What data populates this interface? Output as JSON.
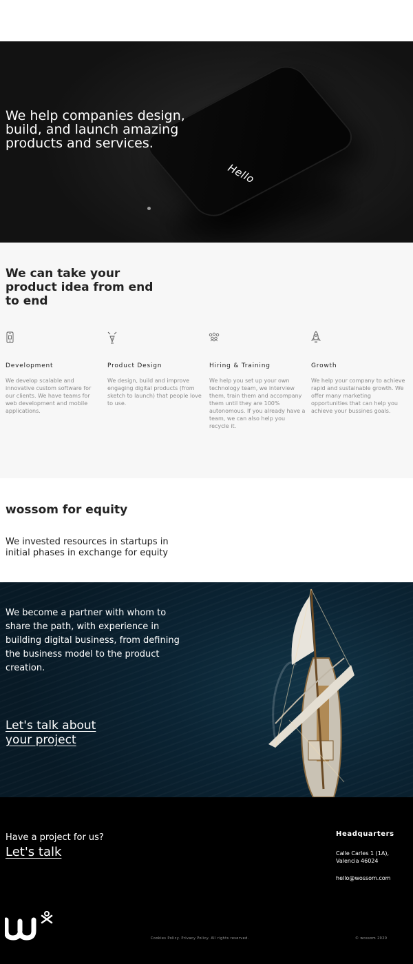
{
  "hero": {
    "title": "We help companies design, build, and launch amazing products and services.",
    "phone_text": "Hello"
  },
  "services": {
    "title": "We can take your product idea from end to end",
    "items": [
      {
        "icon": "phone-icon",
        "title": "Development",
        "desc": "We develop scalable and innovative custom software for our clients. We have teams for web development and mobile applications."
      },
      {
        "icon": "pen-nib-icon",
        "title": "Product Design",
        "desc": "We design, build and improve engaging digital products (from sketch to launch) that people love to use."
      },
      {
        "icon": "team-icon",
        "title": "Hiring & Training",
        "desc": "We help you set up your own technology team, we interview them, train them and accompany them until they are 100% autonomous. If you already have a team, we can also help you recycle it."
      },
      {
        "icon": "rocket-icon",
        "title": "Growth",
        "desc": "We help your company to achieve rapid and sustainable growth. We offer many marketing opportunities that can help you achieve your bussines goals."
      }
    ]
  },
  "equity": {
    "title": "wossom for equity",
    "subtitle": "We invested resources in startups in initial phases in exchange for equity"
  },
  "partner": {
    "text": "We become a partner with whom to share the path, with experience in building digital business, from defining the business model to the product creation.",
    "cta": "Let's talk about your project"
  },
  "footer": {
    "ask": "Have a project for us?",
    "talk": "Let's talk",
    "hq_title": "Headquarters",
    "address": "Calle Carles 1 (1A), Valencia 46024",
    "email": "hello@wossom.com",
    "legal": "Cookies Policy. Privacy Policy. All rights reserved.",
    "copyright": "© wossom 2020"
  },
  "colors": {
    "footer_bg": "#000000",
    "services_bg": "#f7f7f7",
    "text_dark": "#222222",
    "text_muted": "#8a8a8a"
  }
}
